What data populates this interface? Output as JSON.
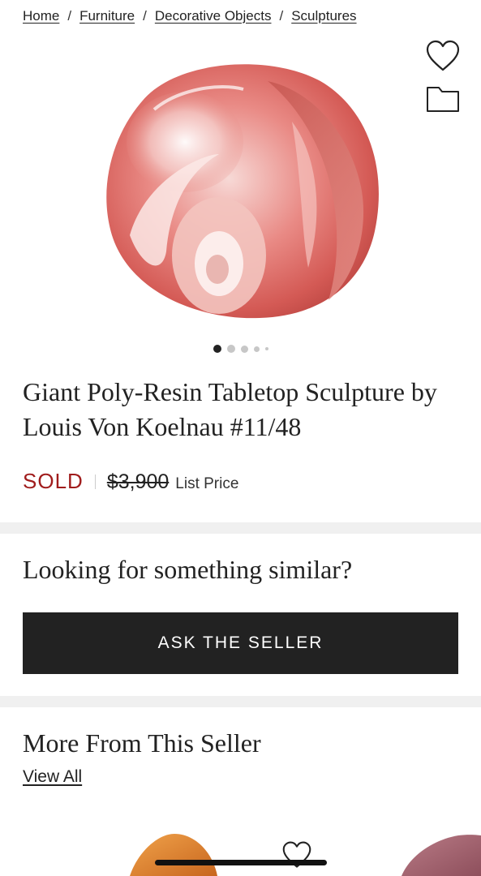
{
  "breadcrumb": [
    {
      "label": "Home"
    },
    {
      "label": "Furniture"
    },
    {
      "label": "Decorative Objects"
    },
    {
      "label": "Sculptures"
    }
  ],
  "breadcrumb_separator": "/",
  "product": {
    "title": "Giant Poly-Resin Tabletop Sculpture by Louis Von Koelnau #11/48",
    "status": "SOLD",
    "list_price": "$3,900",
    "list_price_label": "List Price",
    "image_count_dots": 5,
    "active_image_index": 0
  },
  "similar": {
    "heading": "Looking for something similar?",
    "button_label": "ASK THE SELLER"
  },
  "more_from_seller": {
    "heading": "More From This Seller",
    "view_all_label": "View All"
  },
  "icons": {
    "favorite": "heart-icon",
    "save_to_folder": "folder-icon"
  },
  "colors": {
    "sold": "#a01c1c",
    "button_bg": "#222222",
    "section_band": "#f0f0f0"
  }
}
